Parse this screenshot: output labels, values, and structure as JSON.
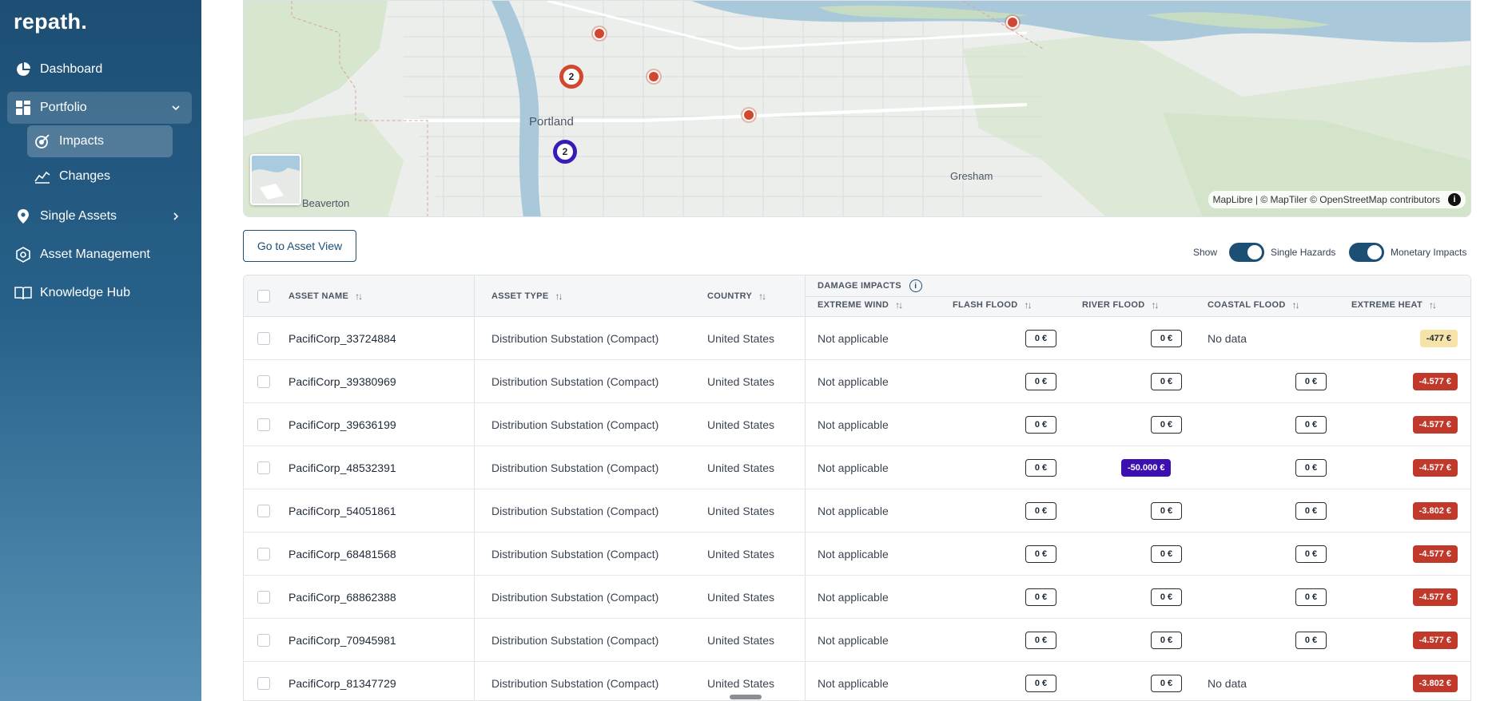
{
  "sidebar": {
    "logo": "repath.",
    "items": [
      {
        "label": "Dashboard",
        "icon": "pie-chart-icon"
      },
      {
        "label": "Portfolio",
        "icon": "grid-icon"
      },
      {
        "label": "Single Assets",
        "icon": "location-pin-icon"
      },
      {
        "label": "Asset Management",
        "icon": "shield-icon"
      },
      {
        "label": "Knowledge Hub",
        "icon": "book-icon"
      }
    ],
    "portfolio_sub": [
      {
        "label": "Impacts",
        "icon": "impact-icon"
      },
      {
        "label": "Changes",
        "icon": "line-chart-icon"
      }
    ]
  },
  "map": {
    "labels": {
      "portland": "Portland",
      "gresham": "Gresham",
      "beaverton": "Beaverton"
    },
    "cluster_orange": "2",
    "cluster_purple": "2",
    "attribution": "MapLibre | © MapTiler © OpenStreetMap contributors",
    "info_glyph": "i"
  },
  "controls": {
    "asset_view_button": "Go to Asset View",
    "show_label": "Show",
    "single_hazards": "Single Hazards",
    "monetary_impacts": "Monetary Impacts"
  },
  "table": {
    "headers": {
      "asset_name": "ASSET NAME",
      "asset_type": "ASSET TYPE",
      "country": "COUNTRY",
      "damage_impacts": "DAMAGE IMPACTS",
      "extreme_wind": "EXTREME WIND",
      "flash_flood": "FLASH FLOOD",
      "river_flood": "RIVER FLOOD",
      "coastal_flood": "COASTAL FLOOD",
      "extreme_heat": "EXTREME HEAT"
    },
    "rows": [
      {
        "name": "PacifiCorp_33724884",
        "type": "Distribution Substation (Compact)",
        "country": "United States",
        "wind": "Not applicable",
        "flash": "0 €",
        "river": "0 €",
        "coastal": "No data",
        "heat": "-477 €"
      },
      {
        "name": "PacifiCorp_39380969",
        "type": "Distribution Substation (Compact)",
        "country": "United States",
        "wind": "Not applicable",
        "flash": "0 €",
        "river": "0 €",
        "coastal": "0 €",
        "heat": "-4.577 €"
      },
      {
        "name": "PacifiCorp_39636199",
        "type": "Distribution Substation (Compact)",
        "country": "United States",
        "wind": "Not applicable",
        "flash": "0 €",
        "river": "0 €",
        "coastal": "0 €",
        "heat": "-4.577 €"
      },
      {
        "name": "PacifiCorp_48532391",
        "type": "Distribution Substation (Compact)",
        "country": "United States",
        "wind": "Not applicable",
        "flash": "0 €",
        "river": "-50.000 €",
        "coastal": "0 €",
        "heat": "-4.577 €"
      },
      {
        "name": "PacifiCorp_54051861",
        "type": "Distribution Substation (Compact)",
        "country": "United States",
        "wind": "Not applicable",
        "flash": "0 €",
        "river": "0 €",
        "coastal": "0 €",
        "heat": "-3.802 €"
      },
      {
        "name": "PacifiCorp_68481568",
        "type": "Distribution Substation (Compact)",
        "country": "United States",
        "wind": "Not applicable",
        "flash": "0 €",
        "river": "0 €",
        "coastal": "0 €",
        "heat": "-4.577 €"
      },
      {
        "name": "PacifiCorp_68862388",
        "type": "Distribution Substation (Compact)",
        "country": "United States",
        "wind": "Not applicable",
        "flash": "0 €",
        "river": "0 €",
        "coastal": "0 €",
        "heat": "-4.577 €"
      },
      {
        "name": "PacifiCorp_70945981",
        "type": "Distribution Substation (Compact)",
        "country": "United States",
        "wind": "Not applicable",
        "flash": "0 €",
        "river": "0 €",
        "coastal": "0 €",
        "heat": "-4.577 €"
      },
      {
        "name": "PacifiCorp_81347729",
        "type": "Distribution Substation (Compact)",
        "country": "United States",
        "wind": "Not applicable",
        "flash": "0 €",
        "river": "0 €",
        "coastal": "No data",
        "heat": "-3.802 €"
      }
    ]
  },
  "colors": {
    "brand": "#1d4e74",
    "marker": "#d1472f",
    "cluster_purple": "#3b1bb8",
    "heat_high": "#c0392b",
    "heat_low_bg": "#f7e3a8",
    "river_impact": "#3b0fb0"
  }
}
